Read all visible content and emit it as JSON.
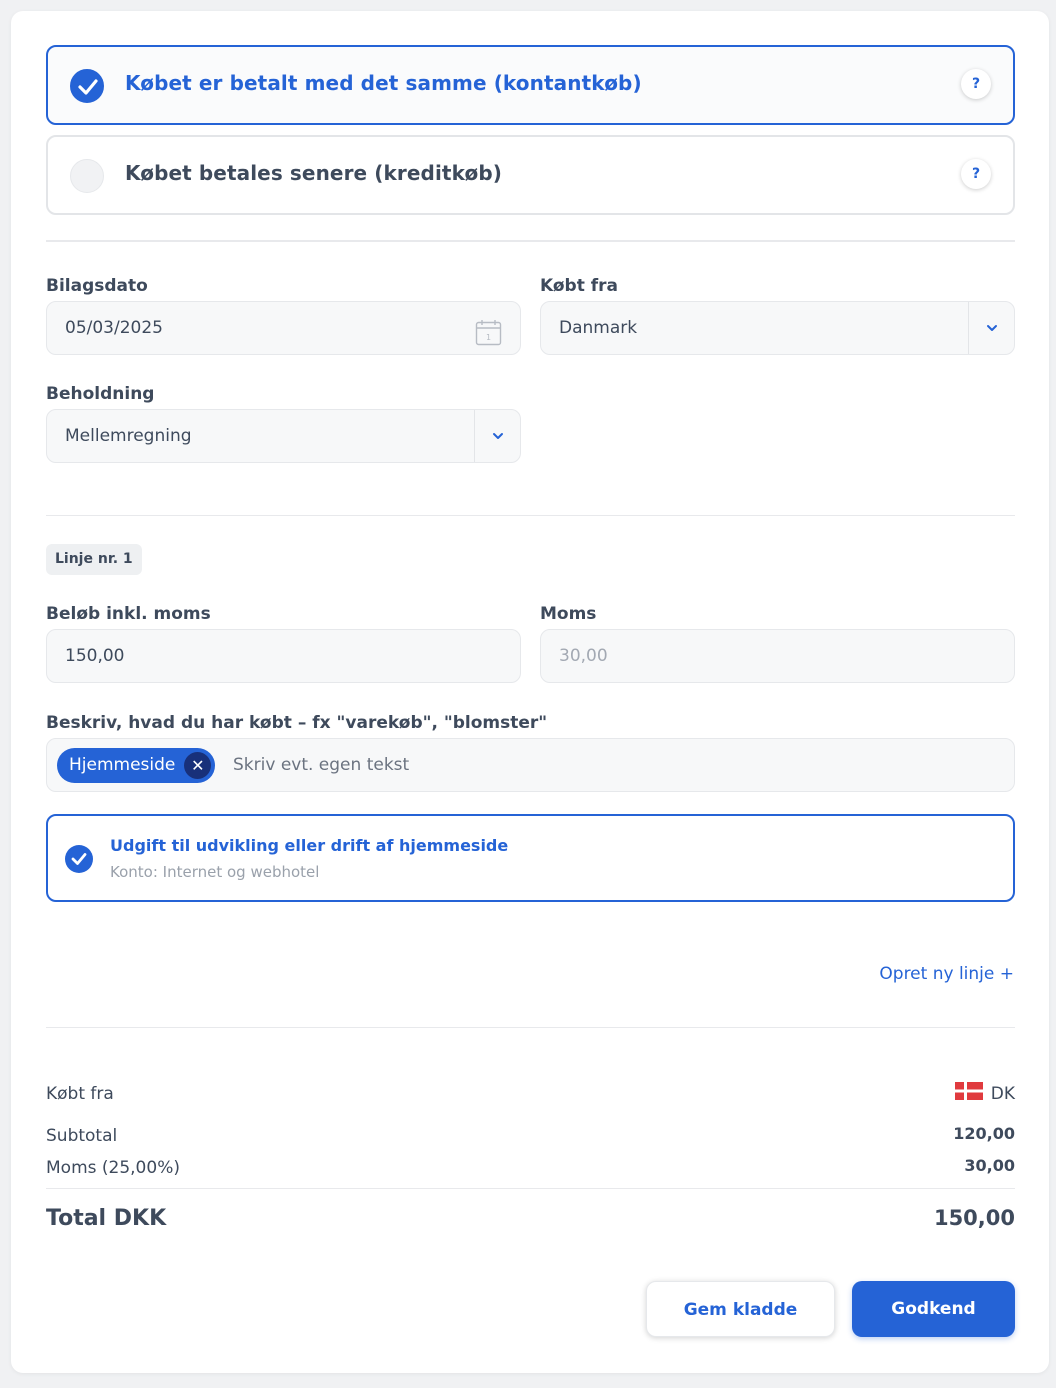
{
  "payment_options": [
    {
      "label": "Købet er betalt med det samme (kontantkøb)",
      "selected": true,
      "help": "?"
    },
    {
      "label": "Købet betales senere (kreditkøb)",
      "selected": false,
      "help": "?"
    }
  ],
  "form": {
    "bilagsdato_label": "Bilagsdato",
    "bilagsdato_value": "05/03/2025",
    "calendar_day": "1",
    "koebt_fra_label": "Købt fra",
    "koebt_fra_value": "Danmark",
    "beholdning_label": "Beholdning",
    "beholdning_value": "Mellemregning"
  },
  "line": {
    "badge": "Linje nr. 1",
    "beloeb_label": "Beløb inkl. moms",
    "beloeb_value": "150,00",
    "moms_label": "Moms",
    "moms_value": "30,00",
    "desc_label": "Beskriv, hvad du har købt – fx \"varekøb\", \"blomster\"",
    "tag": "Hjemmeside",
    "tag_remove": "✕",
    "desc_placeholder": "Skriv evt. egen tekst",
    "suggestion_title": "Udgift til udvikling eller drift af hjemmeside",
    "suggestion_sub": "Konto: Internet og webhotel",
    "new_line": "Opret ny linje +"
  },
  "summary": {
    "koebt_fra_label": "Købt fra",
    "country_code": "DK",
    "flag_colors": {
      "red": "#e03a3e",
      "white": "#ffffff"
    },
    "subtotal_label": "Subtotal",
    "subtotal_value": "120,00",
    "moms_label": "Moms (25,00%)",
    "moms_value": "30,00",
    "total_label": "Total DKK",
    "total_value": "150,00"
  },
  "actions": {
    "save_draft": "Gem kladde",
    "approve": "Godkend"
  },
  "colors": {
    "accent": "#2563d6",
    "text": "#3e4a5c",
    "muted": "#9aa1ab"
  }
}
